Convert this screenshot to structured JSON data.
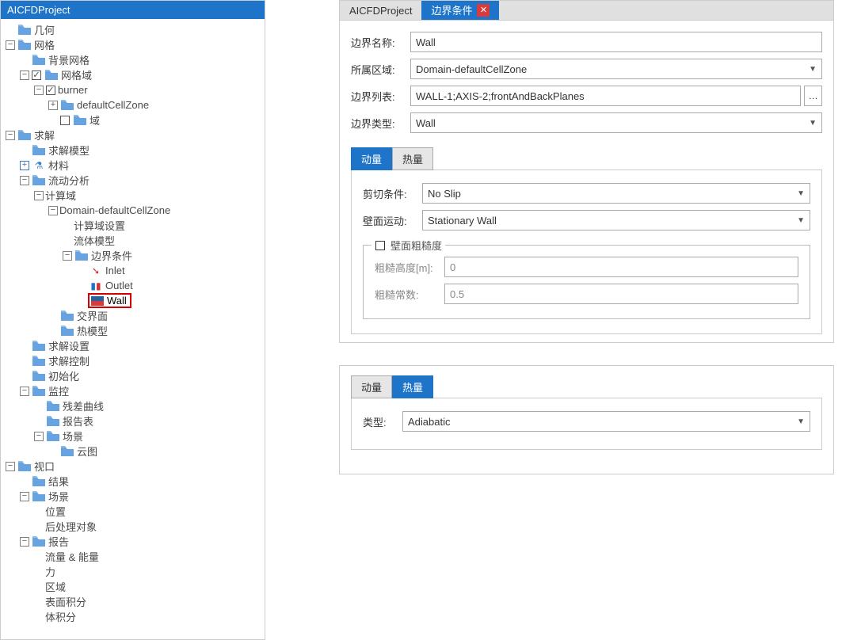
{
  "tree": {
    "title": "AICFDProject",
    "items": {
      "geometry": "几何",
      "mesh": "网格",
      "bg_mesh": "背景网格",
      "mesh_domain": "网格域",
      "burner": "burner",
      "default_zone": "defaultCellZone",
      "domain_child": "域",
      "solve": "求解",
      "solve_model": "求解模型",
      "materials": "材料",
      "flow_analysis": "流动分析",
      "compute_domain": "计算域",
      "domain_default": "Domain-defaultCellZone",
      "compute_settings": "计算域设置",
      "fluid_model": "流体模型",
      "bc": "边界条件",
      "inlet": "Inlet",
      "outlet": "Outlet",
      "wall": "Wall",
      "interface": "交界面",
      "heat_model": "热模型",
      "solve_settings": "求解设置",
      "solve_control": "求解控制",
      "init": "初始化",
      "monitor": "监控",
      "residual": "残差曲线",
      "report_table": "报告表",
      "scene_top": "场景",
      "cloud": "云图",
      "viewport": "视口",
      "result": "结果",
      "scene2": "场景",
      "position": "位置",
      "postproc": "后处理对象",
      "report": "报告",
      "flow_energy": "流量 & 能量",
      "force": "力",
      "region": "区域",
      "surface_integral": "表面积分",
      "volume_integral": "体积分"
    }
  },
  "prop1": {
    "header_tab1": "AICFDProject",
    "header_tab2": "边界条件",
    "name_label": "边界名称:",
    "name_value": "Wall",
    "region_label": "所属区域:",
    "region_value": "Domain-defaultCellZone",
    "list_label": "边界列表:",
    "list_value": "WALL-1;AXIS-2;frontAndBackPlanes",
    "type_label": "边界类型:",
    "type_value": "Wall",
    "tab_momentum": "动量",
    "tab_heat": "热量",
    "shear_label": "剪切条件:",
    "shear_value": "No Slip",
    "wallmotion_label": "壁面运动:",
    "wallmotion_value": "Stationary Wall",
    "roughness_legend": "壁面粗糙度",
    "rough_height_label": "粗糙高度[m]:",
    "rough_height_value": "0",
    "rough_const_label": "粗糙常数:",
    "rough_const_value": "0.5"
  },
  "prop2": {
    "tab_momentum": "动量",
    "tab_heat": "热量",
    "type_label": "类型:",
    "type_value": "Adiabatic"
  }
}
